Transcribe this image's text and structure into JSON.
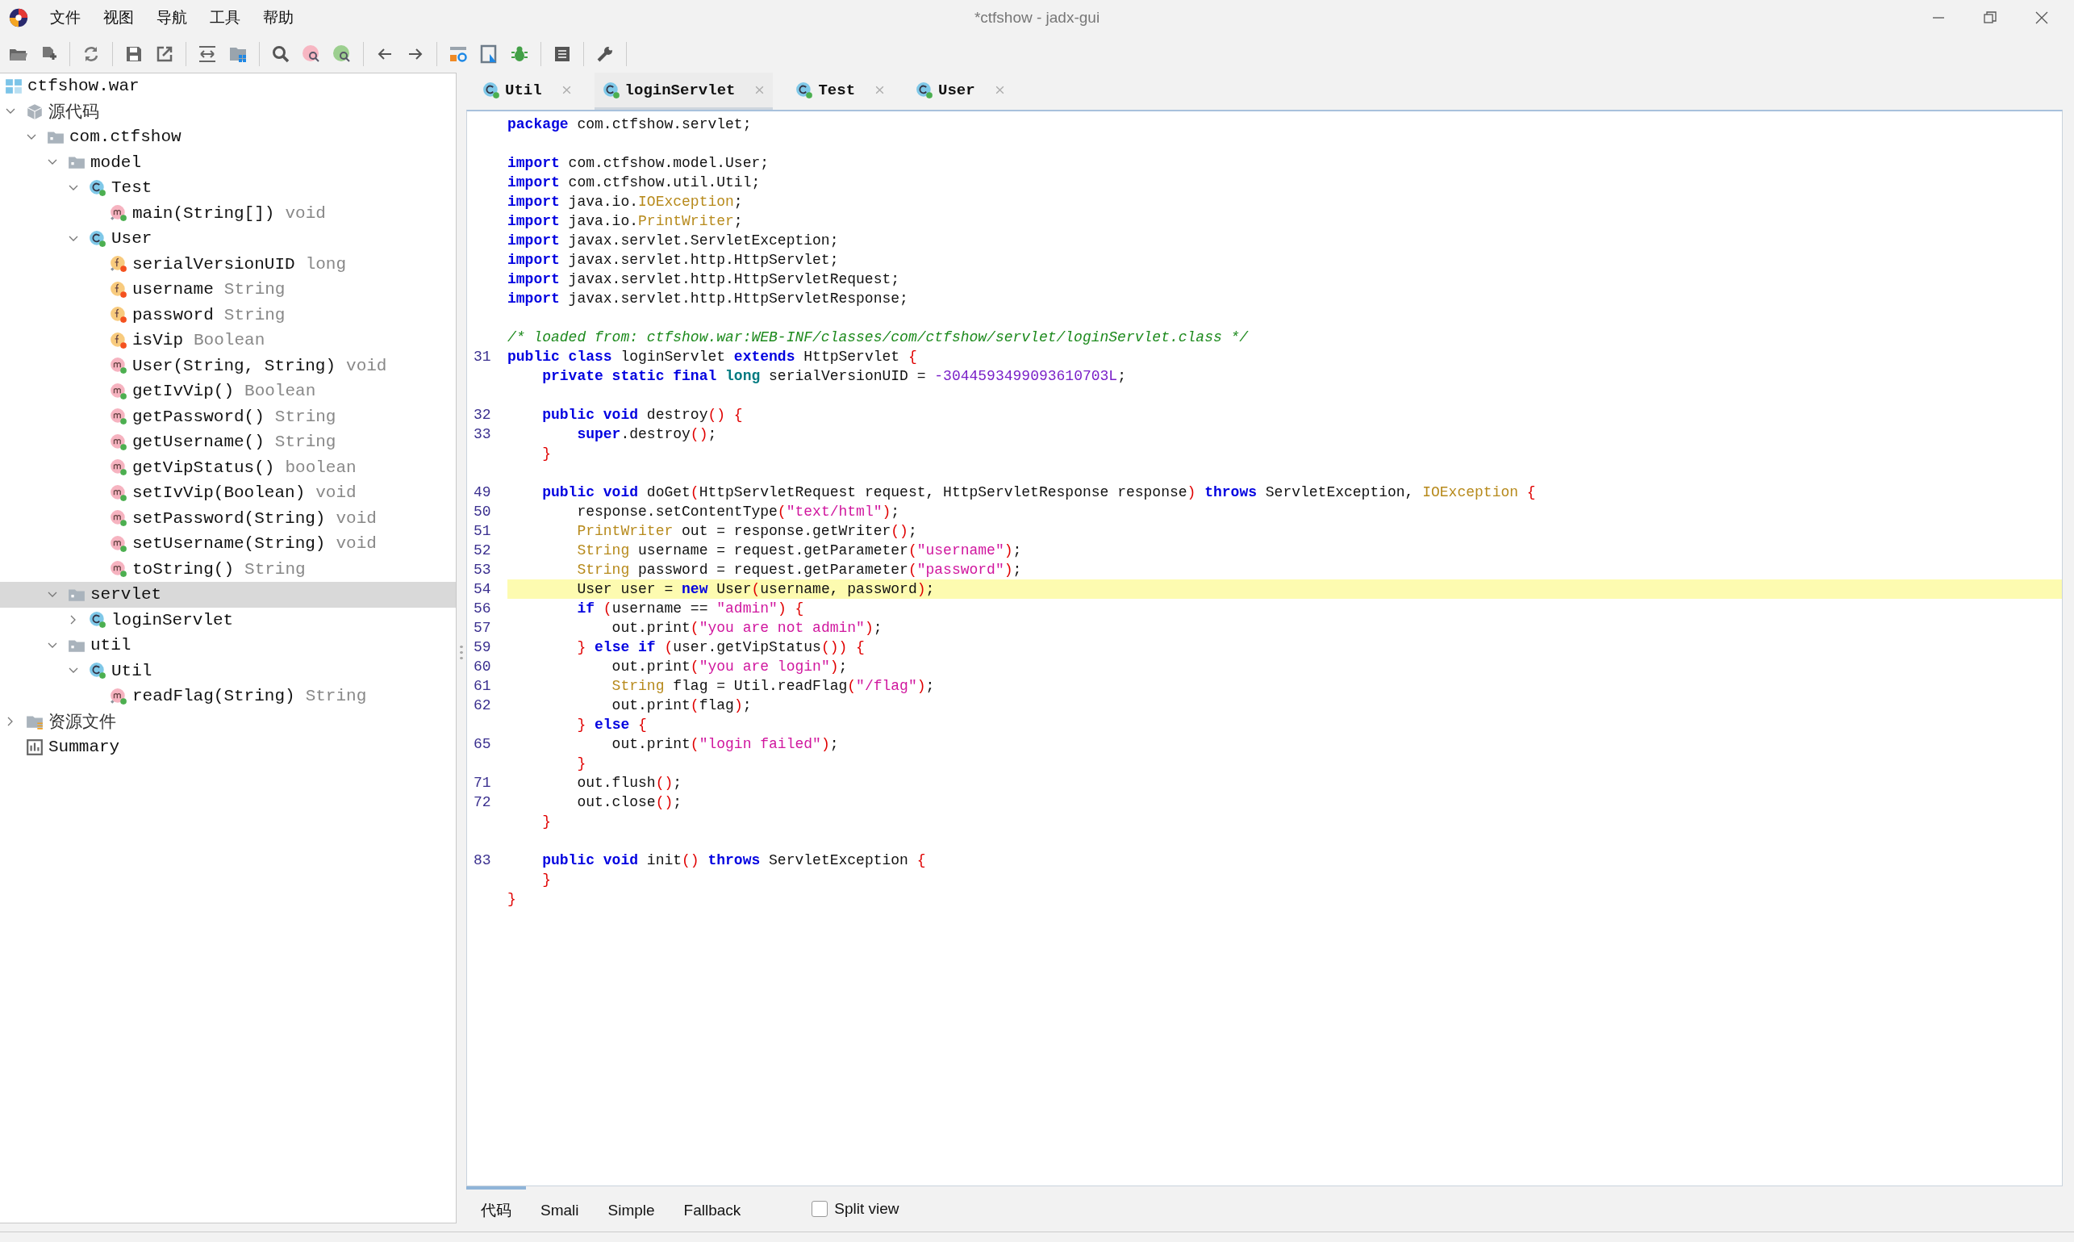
{
  "window": {
    "title": "*ctfshow - jadx-gui"
  },
  "menu": [
    "文件",
    "视图",
    "导航",
    "工具",
    "帮助"
  ],
  "tree": {
    "root": {
      "label": "ctfshow.war",
      "kind": "archive"
    },
    "items": [
      {
        "label": "源代码",
        "kind": "sources",
        "expanded": true,
        "selected": false,
        "children": [
          {
            "label": "com.ctfshow",
            "kind": "package",
            "expanded": true,
            "selected": false,
            "children": [
              {
                "label": "model",
                "kind": "package",
                "expanded": true,
                "selected": false,
                "children": [
                  {
                    "label": "Test",
                    "kind": "class",
                    "expanded": true,
                    "selected": false,
                    "children": [
                      {
                        "label": "main(String[])",
                        "type": "void",
                        "kind": "static-method",
                        "selected": false
                      }
                    ]
                  },
                  {
                    "label": "User",
                    "kind": "class",
                    "expanded": true,
                    "selected": false,
                    "children": [
                      {
                        "label": "serialVersionUID",
                        "type": "long",
                        "kind": "static-field",
                        "selected": false
                      },
                      {
                        "label": "username",
                        "type": "String",
                        "kind": "field",
                        "selected": false
                      },
                      {
                        "label": "password",
                        "type": "String",
                        "kind": "field",
                        "selected": false
                      },
                      {
                        "label": "isVip",
                        "type": "Boolean",
                        "kind": "field",
                        "selected": false
                      },
                      {
                        "label": "User(String, String)",
                        "type": "void",
                        "kind": "method",
                        "selected": false
                      },
                      {
                        "label": "getIvVip()",
                        "type": "Boolean",
                        "kind": "method",
                        "selected": false
                      },
                      {
                        "label": "getPassword()",
                        "type": "String",
                        "kind": "method",
                        "selected": false
                      },
                      {
                        "label": "getUsername()",
                        "type": "String",
                        "kind": "method",
                        "selected": false
                      },
                      {
                        "label": "getVipStatus()",
                        "type": "boolean",
                        "kind": "method",
                        "selected": false
                      },
                      {
                        "label": "setIvVip(Boolean)",
                        "type": "void",
                        "kind": "method",
                        "selected": false
                      },
                      {
                        "label": "setPassword(String)",
                        "type": "void",
                        "kind": "method",
                        "selected": false
                      },
                      {
                        "label": "setUsername(String)",
                        "type": "void",
                        "kind": "method",
                        "selected": false
                      },
                      {
                        "label": "toString()",
                        "type": "String",
                        "kind": "method",
                        "selected": false
                      }
                    ]
                  }
                ]
              },
              {
                "label": "servlet",
                "kind": "package",
                "expanded": true,
                "selected": true,
                "children": [
                  {
                    "label": "loginServlet",
                    "kind": "class",
                    "expanded": false,
                    "selected": false
                  }
                ]
              },
              {
                "label": "util",
                "kind": "package",
                "expanded": true,
                "selected": false,
                "children": [
                  {
                    "label": "Util",
                    "kind": "class",
                    "expanded": true,
                    "selected": false,
                    "children": [
                      {
                        "label": "readFlag(String)",
                        "type": "String",
                        "kind": "static-method",
                        "selected": false
                      }
                    ]
                  }
                ]
              }
            ]
          }
        ]
      },
      {
        "label": "资源文件",
        "kind": "resources",
        "expanded": false,
        "selected": false
      },
      {
        "label": "Summary",
        "kind": "summary",
        "selected": false
      }
    ]
  },
  "tabs": [
    {
      "label": "Util",
      "selected": false
    },
    {
      "label": "loginServlet",
      "selected": true
    },
    {
      "label": "Test",
      "selected": false
    },
    {
      "label": "User",
      "selected": false
    }
  ],
  "code": [
    {
      "highlighted": false,
      "tokens": [
        {
          "kind": "keyword",
          "text": "package"
        },
        {
          "kind": "plain",
          "text": " com.ctfshow.servlet;"
        }
      ]
    },
    {
      "highlighted": false
    },
    {
      "highlighted": false,
      "tokens": [
        {
          "kind": "keyword",
          "text": "import"
        },
        {
          "kind": "plain",
          "text": " com.ctfshow.model.User;"
        }
      ]
    },
    {
      "highlighted": false,
      "tokens": [
        {
          "kind": "keyword",
          "text": "import"
        },
        {
          "kind": "plain",
          "text": " com.ctfshow.util.Util;"
        }
      ]
    },
    {
      "highlighted": false,
      "tokens": [
        {
          "kind": "keyword",
          "text": "import"
        },
        {
          "kind": "plain",
          "text": " java.io."
        },
        {
          "kind": "type",
          "text": "IOException"
        },
        {
          "kind": "plain",
          "text": ";"
        }
      ]
    },
    {
      "highlighted": false,
      "tokens": [
        {
          "kind": "keyword",
          "text": "import"
        },
        {
          "kind": "plain",
          "text": " java.io."
        },
        {
          "kind": "type",
          "text": "PrintWriter"
        },
        {
          "kind": "plain",
          "text": ";"
        }
      ]
    },
    {
      "highlighted": false,
      "tokens": [
        {
          "kind": "keyword",
          "text": "import"
        },
        {
          "kind": "plain",
          "text": " javax.servlet.ServletException;"
        }
      ]
    },
    {
      "highlighted": false,
      "tokens": [
        {
          "kind": "keyword",
          "text": "import"
        },
        {
          "kind": "plain",
          "text": " javax.servlet.http.HttpServlet;"
        }
      ]
    },
    {
      "highlighted": false,
      "tokens": [
        {
          "kind": "keyword",
          "text": "import"
        },
        {
          "kind": "plain",
          "text": " javax.servlet.http.HttpServletRequest;"
        }
      ]
    },
    {
      "highlighted": false,
      "tokens": [
        {
          "kind": "keyword",
          "text": "import"
        },
        {
          "kind": "plain",
          "text": " javax.servlet.http.HttpServletResponse;"
        }
      ]
    },
    {
      "highlighted": false
    },
    {
      "highlighted": false,
      "tokens": [
        {
          "kind": "comment",
          "text": "/* loaded from: ctfshow.war:WEB-INF/classes/com/ctfshow/servlet/loginServlet.class */"
        }
      ]
    },
    {
      "num": "31",
      "highlighted": false,
      "tokens": [
        {
          "kind": "keyword",
          "text": "public class"
        },
        {
          "kind": "plain",
          "text": " loginServlet "
        },
        {
          "kind": "keyword",
          "text": "extends"
        },
        {
          "kind": "plain",
          "text": " HttpServlet "
        },
        {
          "kind": "bracket",
          "text": "{"
        }
      ]
    },
    {
      "highlighted": false,
      "tokens": [
        {
          "kind": "keyword",
          "text": "    private static final "
        },
        {
          "kind": "primitive",
          "text": "long"
        },
        {
          "kind": "plain",
          "text": " serialVersionUID = "
        },
        {
          "kind": "number",
          "text": "-3044593499093610703L"
        },
        {
          "kind": "plain",
          "text": ";"
        }
      ]
    },
    {
      "highlighted": false
    },
    {
      "num": "32",
      "highlighted": false,
      "tokens": [
        {
          "kind": "keyword",
          "text": "    public void"
        },
        {
          "kind": "plain",
          "text": " destroy"
        },
        {
          "kind": "bracket",
          "text": "() {"
        }
      ]
    },
    {
      "num": "33",
      "highlighted": false,
      "tokens": [
        {
          "kind": "keyword",
          "text": "        super"
        },
        {
          "kind": "plain",
          "text": ".destroy"
        },
        {
          "kind": "bracket",
          "text": "()"
        },
        {
          "kind": "plain",
          "text": ";"
        }
      ]
    },
    {
      "highlighted": false,
      "tokens": [
        {
          "kind": "bracket",
          "text": "    }"
        }
      ]
    },
    {
      "highlighted": false
    },
    {
      "num": "49",
      "highlighted": false,
      "tokens": [
        {
          "kind": "keyword",
          "text": "    public void"
        },
        {
          "kind": "plain",
          "text": " doGet"
        },
        {
          "kind": "bracket",
          "text": "("
        },
        {
          "kind": "plain",
          "text": "HttpServletRequest request, HttpServletResponse response"
        },
        {
          "kind": "bracket",
          "text": ") "
        },
        {
          "kind": "keyword",
          "text": "throws"
        },
        {
          "kind": "plain",
          "text": " ServletException, "
        },
        {
          "kind": "type",
          "text": "IOException"
        },
        {
          "kind": "bracket",
          "text": " {"
        }
      ]
    },
    {
      "num": "50",
      "highlighted": false,
      "tokens": [
        {
          "kind": "plain",
          "text": "        response.setContentType"
        },
        {
          "kind": "bracket",
          "text": "("
        },
        {
          "kind": "string",
          "text": "\"text/html\""
        },
        {
          "kind": "bracket",
          "text": ")"
        },
        {
          "kind": "plain",
          "text": ";"
        }
      ]
    },
    {
      "num": "51",
      "highlighted": false,
      "tokens": [
        {
          "kind": "type",
          "text": "        PrintWriter"
        },
        {
          "kind": "plain",
          "text": " out = response.getWriter"
        },
        {
          "kind": "bracket",
          "text": "()"
        },
        {
          "kind": "plain",
          "text": ";"
        }
      ]
    },
    {
      "num": "52",
      "highlighted": false,
      "tokens": [
        {
          "kind": "type",
          "text": "        String"
        },
        {
          "kind": "plain",
          "text": " username = request.getParameter"
        },
        {
          "kind": "bracket",
          "text": "("
        },
        {
          "kind": "string",
          "text": "\"username\""
        },
        {
          "kind": "bracket",
          "text": ")"
        },
        {
          "kind": "plain",
          "text": ";"
        }
      ]
    },
    {
      "num": "53",
      "highlighted": false,
      "tokens": [
        {
          "kind": "type",
          "text": "        String"
        },
        {
          "kind": "plain",
          "text": " password = request.getParameter"
        },
        {
          "kind": "bracket",
          "text": "("
        },
        {
          "kind": "string",
          "text": "\"password\""
        },
        {
          "kind": "bracket",
          "text": ")"
        },
        {
          "kind": "plain",
          "text": ";"
        }
      ]
    },
    {
      "num": "54",
      "highlighted": true,
      "tokens": [
        {
          "kind": "plain",
          "text": "        User user = "
        },
        {
          "kind": "keyword",
          "text": "new"
        },
        {
          "kind": "plain",
          "text": " User"
        },
        {
          "kind": "bracket",
          "text": "("
        },
        {
          "kind": "plain",
          "text": "username, password"
        },
        {
          "kind": "bracket",
          "text": ")"
        },
        {
          "kind": "plain",
          "text": ";"
        }
      ]
    },
    {
      "num": "56",
      "highlighted": false,
      "tokens": [
        {
          "kind": "keyword",
          "text": "        if "
        },
        {
          "kind": "bracket",
          "text": "("
        },
        {
          "kind": "plain",
          "text": "username == "
        },
        {
          "kind": "string",
          "text": "\"admin\""
        },
        {
          "kind": "bracket",
          "text": ") {"
        }
      ]
    },
    {
      "num": "57",
      "highlighted": false,
      "tokens": [
        {
          "kind": "plain",
          "text": "            out.print"
        },
        {
          "kind": "bracket",
          "text": "("
        },
        {
          "kind": "string",
          "text": "\"you are not admin\""
        },
        {
          "kind": "bracket",
          "text": ")"
        },
        {
          "kind": "plain",
          "text": ";"
        }
      ]
    },
    {
      "num": "59",
      "highlighted": false,
      "tokens": [
        {
          "kind": "bracket",
          "text": "        } "
        },
        {
          "kind": "keyword",
          "text": "else if "
        },
        {
          "kind": "bracket",
          "text": "("
        },
        {
          "kind": "plain",
          "text": "user.getVipStatus"
        },
        {
          "kind": "bracket",
          "text": "()) {"
        }
      ]
    },
    {
      "num": "60",
      "highlighted": false,
      "tokens": [
        {
          "kind": "plain",
          "text": "            out.print"
        },
        {
          "kind": "bracket",
          "text": "("
        },
        {
          "kind": "string",
          "text": "\"you are login\""
        },
        {
          "kind": "bracket",
          "text": ")"
        },
        {
          "kind": "plain",
          "text": ";"
        }
      ]
    },
    {
      "num": "61",
      "highlighted": false,
      "tokens": [
        {
          "kind": "type",
          "text": "            String"
        },
        {
          "kind": "plain",
          "text": " flag = Util.readFlag"
        },
        {
          "kind": "bracket",
          "text": "("
        },
        {
          "kind": "string",
          "text": "\"/flag\""
        },
        {
          "kind": "bracket",
          "text": ")"
        },
        {
          "kind": "plain",
          "text": ";"
        }
      ]
    },
    {
      "num": "62",
      "highlighted": false,
      "tokens": [
        {
          "kind": "plain",
          "text": "            out.print"
        },
        {
          "kind": "bracket",
          "text": "("
        },
        {
          "kind": "plain",
          "text": "flag"
        },
        {
          "kind": "bracket",
          "text": ")"
        },
        {
          "kind": "plain",
          "text": ";"
        }
      ]
    },
    {
      "highlighted": false,
      "tokens": [
        {
          "kind": "bracket",
          "text": "        } "
        },
        {
          "kind": "keyword",
          "text": "else"
        },
        {
          "kind": "bracket",
          "text": " {"
        }
      ]
    },
    {
      "num": "65",
      "highlighted": false,
      "tokens": [
        {
          "kind": "plain",
          "text": "            out.print"
        },
        {
          "kind": "bracket",
          "text": "("
        },
        {
          "kind": "string",
          "text": "\"login failed\""
        },
        {
          "kind": "bracket",
          "text": ")"
        },
        {
          "kind": "plain",
          "text": ";"
        }
      ]
    },
    {
      "highlighted": false,
      "tokens": [
        {
          "kind": "bracket",
          "text": "        }"
        }
      ]
    },
    {
      "num": "71",
      "highlighted": false,
      "tokens": [
        {
          "kind": "plain",
          "text": "        out.flush"
        },
        {
          "kind": "bracket",
          "text": "()"
        },
        {
          "kind": "plain",
          "text": ";"
        }
      ]
    },
    {
      "num": "72",
      "highlighted": false,
      "tokens": [
        {
          "kind": "plain",
          "text": "        out.close"
        },
        {
          "kind": "bracket",
          "text": "()"
        },
        {
          "kind": "plain",
          "text": ";"
        }
      ]
    },
    {
      "highlighted": false,
      "tokens": [
        {
          "kind": "bracket",
          "text": "    }"
        }
      ]
    },
    {
      "highlighted": false
    },
    {
      "num": "83",
      "highlighted": false,
      "tokens": [
        {
          "kind": "keyword",
          "text": "    public void"
        },
        {
          "kind": "plain",
          "text": " init"
        },
        {
          "kind": "bracket",
          "text": "() "
        },
        {
          "kind": "keyword",
          "text": "throws"
        },
        {
          "kind": "plain",
          "text": " ServletException "
        },
        {
          "kind": "bracket",
          "text": "{"
        }
      ]
    },
    {
      "highlighted": false,
      "tokens": [
        {
          "kind": "bracket",
          "text": "    }"
        }
      ]
    },
    {
      "highlighted": false,
      "tokens": [
        {
          "kind": "bracket",
          "text": "}"
        }
      ]
    }
  ],
  "view_tabs": [
    {
      "label": "代码",
      "selected": true
    },
    {
      "label": "Smali",
      "selected": false
    },
    {
      "label": "Simple",
      "selected": false
    },
    {
      "label": "Fallback",
      "selected": false
    }
  ],
  "split_view": {
    "label": "Split view",
    "checked": false
  }
}
